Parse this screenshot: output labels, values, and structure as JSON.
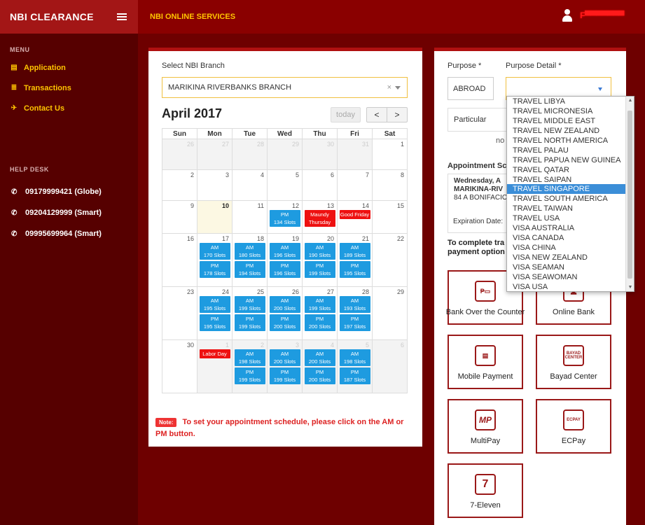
{
  "header": {
    "brand": "NBI CLEARANCE",
    "title": "NBI ONLINE SERVICES",
    "username": "F▀▀▀▀▀▀▀"
  },
  "sidebar": {
    "menu_label": "MENU",
    "items": [
      {
        "label": "Application",
        "icon": "document-icon"
      },
      {
        "label": "Transactions",
        "icon": "list-icon"
      },
      {
        "label": "Contact Us",
        "icon": "send-icon"
      }
    ],
    "help_label": "HELP DESK",
    "help": [
      {
        "label": "09179999421 (Globe)"
      },
      {
        "label": "09204129999 (Smart)"
      },
      {
        "label": "09995699964 (Smart)"
      }
    ]
  },
  "branch": {
    "label": "Select NBI Branch",
    "value": "MARIKINA RIVERBANKS BRANCH",
    "clear": "×"
  },
  "calendar": {
    "month": "April 2017",
    "today_label": "today",
    "prev": "<",
    "next": ">",
    "days": [
      "Sun",
      "Mon",
      "Tue",
      "Wed",
      "Thu",
      "Fri",
      "Sat"
    ],
    "weeks": [
      [
        {
          "d": "26",
          "o": 1
        },
        {
          "d": "27",
          "o": 1
        },
        {
          "d": "28",
          "o": 1
        },
        {
          "d": "29",
          "o": 1
        },
        {
          "d": "30",
          "o": 1
        },
        {
          "d": "31",
          "o": 1
        },
        {
          "d": "1"
        }
      ],
      [
        {
          "d": "2"
        },
        {
          "d": "3"
        },
        {
          "d": "4"
        },
        {
          "d": "5"
        },
        {
          "d": "6"
        },
        {
          "d": "7"
        },
        {
          "d": "8"
        }
      ],
      [
        {
          "d": "9"
        },
        {
          "d": "10",
          "t": 1
        },
        {
          "d": "11"
        },
        {
          "d": "12",
          "s": [
            [
              "PM",
              "134 Slots"
            ]
          ]
        },
        {
          "d": "13",
          "r": "Maundy Thursday"
        },
        {
          "d": "14",
          "r": "Good Friday"
        },
        {
          "d": "15"
        }
      ],
      [
        {
          "d": "16"
        },
        {
          "d": "17",
          "s": [
            [
              "AM",
              "170 Slots"
            ],
            [
              "PM",
              "178 Slots"
            ]
          ]
        },
        {
          "d": "18",
          "s": [
            [
              "AM",
              "180 Slots"
            ],
            [
              "PM",
              "194 Slots"
            ]
          ]
        },
        {
          "d": "19",
          "s": [
            [
              "AM",
              "196 Slots"
            ],
            [
              "PM",
              "196 Slots"
            ]
          ]
        },
        {
          "d": "20",
          "s": [
            [
              "AM",
              "190 Slots"
            ],
            [
              "PM",
              "199 Slots"
            ]
          ]
        },
        {
          "d": "21",
          "s": [
            [
              "AM",
              "189 Slots"
            ],
            [
              "PM",
              "195 Slots"
            ]
          ]
        },
        {
          "d": "22"
        }
      ],
      [
        {
          "d": "23"
        },
        {
          "d": "24",
          "s": [
            [
              "AM",
              "195 Slots"
            ],
            [
              "PM",
              "195 Slots"
            ]
          ]
        },
        {
          "d": "25",
          "s": [
            [
              "AM",
              "199 Slots"
            ],
            [
              "PM",
              "199 Slots"
            ]
          ]
        },
        {
          "d": "26",
          "s": [
            [
              "AM",
              "200 Slots"
            ],
            [
              "PM",
              "200 Slots"
            ]
          ]
        },
        {
          "d": "27",
          "s": [
            [
              "AM",
              "199 Slots"
            ],
            [
              "PM",
              "200 Slots"
            ]
          ]
        },
        {
          "d": "28",
          "s": [
            [
              "AM",
              "193 Slots"
            ],
            [
              "PM",
              "197 Slots"
            ]
          ]
        },
        {
          "d": "29"
        }
      ],
      [
        {
          "d": "30"
        },
        {
          "d": "1",
          "o": 1,
          "r": "Labor Day"
        },
        {
          "d": "2",
          "o": 1,
          "s": [
            [
              "AM",
              "198 Slots"
            ],
            [
              "PM",
              "199 Slots"
            ]
          ]
        },
        {
          "d": "3",
          "o": 1,
          "s": [
            [
              "AM",
              "200 Slots"
            ],
            [
              "PM",
              "199 Slots"
            ]
          ]
        },
        {
          "d": "4",
          "o": 1,
          "s": [
            [
              "AM",
              "200 Slots"
            ],
            [
              "PM",
              "200 Slots"
            ]
          ]
        },
        {
          "d": "5",
          "o": 1,
          "s": [
            [
              "AM",
              "198 Slots"
            ],
            [
              "PM",
              "187 Slots"
            ]
          ]
        },
        {
          "d": "6",
          "o": 1
        }
      ]
    ]
  },
  "note": {
    "tag": "Note:",
    "text": "To set your appointment schedule, please click on the AM or PM button."
  },
  "right": {
    "purpose_label": "Purpose *",
    "purpose_value": "ABROAD",
    "purpose_detail_label": "Purpose Detail *",
    "particular_label": "Particular",
    "no_text": "no",
    "appt_label": "Appointment Sc",
    "appt_line1": "Wednesday, A",
    "appt_line2": "MARIKINA-RIV",
    "appt_line3": "84 A BONIFACIO",
    "expiration": "Expiration Date:",
    "complete_line1": "To complete tra",
    "complete_line2": "payment option"
  },
  "dropdown": {
    "options": [
      "TRAVEL LIBYA",
      "TRAVEL MICRONESIA",
      "TRAVEL MIDDLE EAST",
      "TRAVEL NEW ZEALAND",
      "TRAVEL NORTH AMERICA",
      "TRAVEL PALAU",
      "TRAVEL PAPUA NEW GUINEA",
      "TRAVEL QATAR",
      "TRAVEL SAIPAN",
      "TRAVEL SINGAPORE",
      "TRAVEL SOUTH AMERICA",
      "TRAVEL TAIWAN",
      "TRAVEL USA",
      "VISA AUSTRALIA",
      "VISA CANADA",
      "VISA CHINA",
      "VISA NEW ZEALAND",
      "VISA SEAMAN",
      "VISA SEAWOMAN",
      "VISA USA"
    ],
    "selected": "TRAVEL SINGAPORE"
  },
  "payments": [
    {
      "label": "Bank Over the Counter",
      "icon": "bank-counter-icon",
      "glyph": "₱▭"
    },
    {
      "label": "Online Bank",
      "icon": "online-bank-icon",
      "glyph": "🖥"
    },
    {
      "label": "Mobile Payment",
      "icon": "mobile-payment-icon",
      "glyph": "▤"
    },
    {
      "label": "Bayad Center",
      "icon": "bayad-center-icon",
      "glyph": "BAYAD CENTER"
    },
    {
      "label": "MultiPay",
      "icon": "multipay-icon",
      "glyph": "MP"
    },
    {
      "label": "ECPay",
      "icon": "ecpay-icon",
      "glyph": "ECPAY"
    },
    {
      "label": "7-Eleven",
      "icon": "seven-eleven-icon",
      "glyph": "7"
    }
  ]
}
